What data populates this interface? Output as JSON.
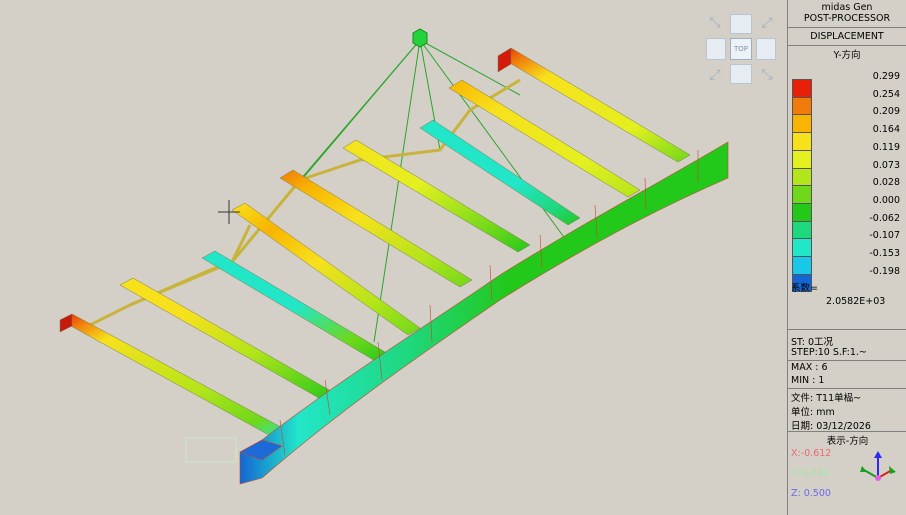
{
  "panel": {
    "program": "midas Gen",
    "module": "POST-PROCESSOR",
    "result_type": "DISPLACEMENT",
    "component": "Y-方向",
    "legend": [
      {
        "value": "0.299",
        "color": "#e8200a"
      },
      {
        "value": "0.254",
        "color": "#f07a0a"
      },
      {
        "value": "0.209",
        "color": "#f8b400"
      },
      {
        "value": "0.164",
        "color": "#f7e11c"
      },
      {
        "value": "0.119",
        "color": "#e4f020"
      },
      {
        "value": "0.073",
        "color": "#b4e51a"
      },
      {
        "value": "0.028",
        "color": "#6fd81a"
      },
      {
        "value": "0.000",
        "color": "#22c81a"
      },
      {
        "value": "-0.062",
        "color": "#1fd77c"
      },
      {
        "value": "-0.107",
        "color": "#22e6c8"
      },
      {
        "value": "-0.153",
        "color": "#19c8e8"
      },
      {
        "value": "-0.198",
        "color": "#1466d4"
      }
    ],
    "factor_label": "系数=",
    "factor_value": "2.0582E+03",
    "step_case": "ST: 0工况",
    "step": "STEP:10 S.F:1.~",
    "max": "MAX : 6",
    "min": "MIN : 1",
    "file": "文件: T11单榀~",
    "unit": "单位: mm",
    "date": "日期: 03/12/2026",
    "view_dir": "表示-方向",
    "axis_x": "X:-0.612",
    "axis_y": "Y:-0.612",
    "axis_z": "Z: 0.500",
    "axis_x_color": "#e86a6a",
    "axis_y_color": "#9ee89e",
    "axis_z_color": "#6a6ae8"
  },
  "viewcube": {
    "top_label": "TOP"
  }
}
